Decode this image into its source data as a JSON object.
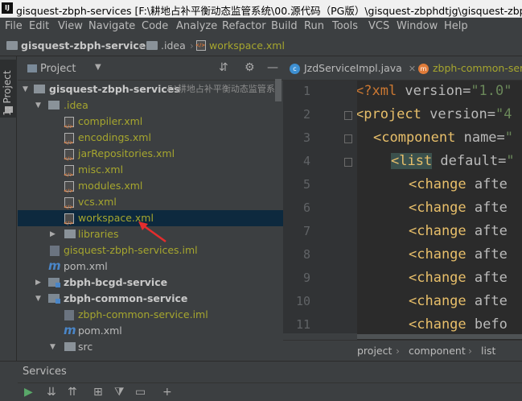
{
  "window": {
    "title": "gisquest-zbph-services [F:\\耕地占补平衡动态监管系统\\00.源代码（PG版）\\gisquest-zbphdtjg\\gisquest-zbph-se"
  },
  "menu": [
    "File",
    "Edit",
    "View",
    "Navigate",
    "Code",
    "Analyze",
    "Refactor",
    "Build",
    "Run",
    "Tools",
    "VCS",
    "Window",
    "Help"
  ],
  "breadcrumb": {
    "project": "gisquest-zbph-services",
    "folder": ".idea",
    "file": "workspace.xml"
  },
  "sidebar": {
    "tab_label": "1: Project"
  },
  "project_panel": {
    "title": "Project",
    "tree": [
      {
        "label": "gisquest-zbph-services",
        "path": "F:\\耕地占补平衡动态监管系"
      },
      {
        "label": ".idea"
      },
      {
        "label": "compiler.xml"
      },
      {
        "label": "encodings.xml"
      },
      {
        "label": "jarRepositories.xml"
      },
      {
        "label": "misc.xml"
      },
      {
        "label": "modules.xml"
      },
      {
        "label": "vcs.xml"
      },
      {
        "label": "workspace.xml"
      },
      {
        "label": "libraries"
      },
      {
        "label": "gisquest-zbph-services.iml"
      },
      {
        "label": "pom.xml"
      },
      {
        "label": "zbph-bcgd-service"
      },
      {
        "label": "zbph-common-service"
      },
      {
        "label": "zbph-common-service.iml"
      },
      {
        "label": "pom.xml"
      },
      {
        "label": "src"
      }
    ]
  },
  "editor": {
    "tabs": [
      {
        "label": "JzdServiceImpl.java",
        "icon": "class-c-icon"
      },
      {
        "label": "zbph-common-ser",
        "icon": "module-icon"
      }
    ],
    "line_numbers": [
      "1",
      "2",
      "3",
      "4",
      "5",
      "6",
      "7",
      "8",
      "9",
      "10",
      "11"
    ],
    "lines": [
      {
        "tag": "<?xml ",
        "attr": "version=",
        "val": "\"1.0\""
      },
      {
        "tag": "<project ",
        "attr": "version=",
        "val": "\"4"
      },
      {
        "tag": "<component ",
        "attr": "name=",
        "val": "\""
      },
      {
        "tag": "<list",
        "attr": " default=",
        "val": "\""
      },
      {
        "tag": "<change ",
        "attr": "afte",
        "val": ""
      },
      {
        "tag": "<change ",
        "attr": "afte",
        "val": ""
      },
      {
        "tag": "<change ",
        "attr": "afte",
        "val": ""
      },
      {
        "tag": "<change ",
        "attr": "afte",
        "val": ""
      },
      {
        "tag": "<change ",
        "attr": "afte",
        "val": ""
      },
      {
        "tag": "<change ",
        "attr": "afte",
        "val": ""
      },
      {
        "tag": "<change ",
        "attr": "befo",
        "val": ""
      }
    ],
    "breadcrumb": [
      "project",
      "component",
      "list"
    ]
  },
  "services": {
    "label": "Services"
  }
}
